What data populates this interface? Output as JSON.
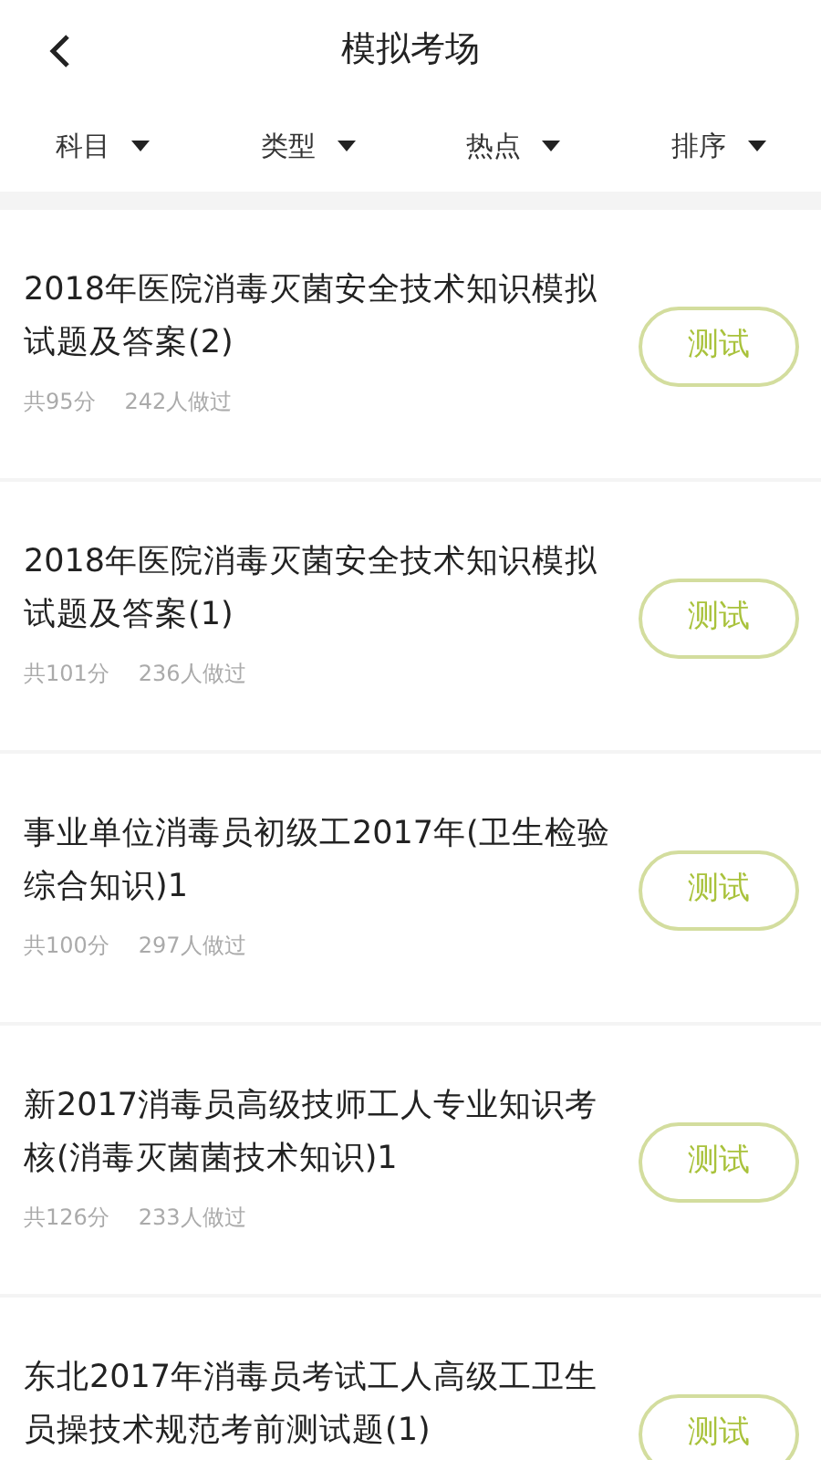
{
  "header": {
    "title": "模拟考场"
  },
  "filters": [
    {
      "label": "科目"
    },
    {
      "label": "类型"
    },
    {
      "label": "热点"
    },
    {
      "label": "排序"
    }
  ],
  "exams": [
    {
      "title": "2018年医院消毒灭菌安全技术知识模拟试题及答案(2)",
      "score": "共95分",
      "takers": "242人做过",
      "action": "测试"
    },
    {
      "title": "2018年医院消毒灭菌安全技术知识模拟试题及答案(1)",
      "score": "共101分",
      "takers": "236人做过",
      "action": "测试"
    },
    {
      "title": "事业单位消毒员初级工2017年(卫生检验综合知识)1",
      "score": "共100分",
      "takers": "297人做过",
      "action": "测试"
    },
    {
      "title": "新2017消毒员高级技师工人专业知识考核(消毒灭菌菌技术知识)1",
      "score": "共126分",
      "takers": "233人做过",
      "action": "测试"
    },
    {
      "title": "东北2017年消毒员考试工人高级工卫生员操技术规范考前测试题(1)",
      "action": "测试"
    }
  ]
}
